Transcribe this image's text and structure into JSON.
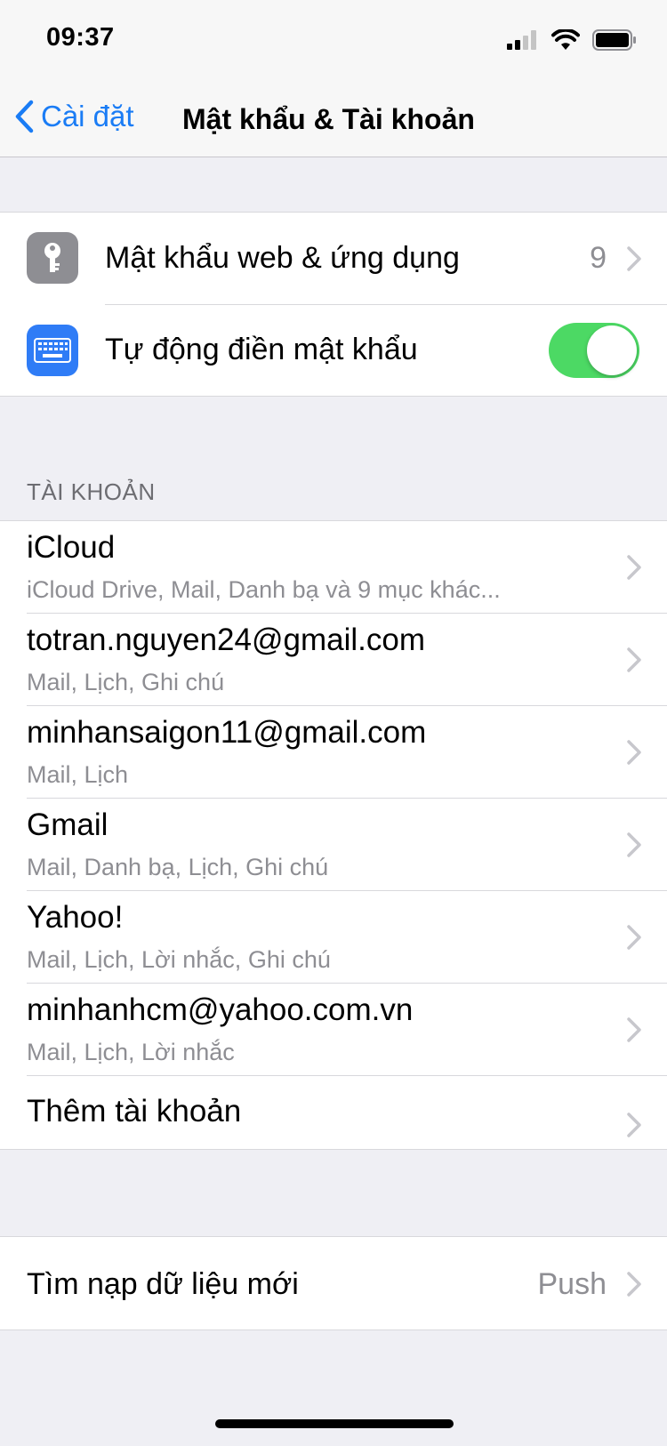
{
  "status_bar": {
    "time": "09:37",
    "icons": [
      "cellular-signal-icon",
      "wifi-icon",
      "battery-icon"
    ]
  },
  "nav": {
    "back_label": "Cài đặt",
    "title": "Mật khẩu & Tài khoản"
  },
  "password_group": {
    "web_passwords": {
      "label": "Mật khẩu web & ứng dụng",
      "value": "9",
      "icon": "key-icon",
      "icon_color": "#8e8e93"
    },
    "autofill": {
      "label": "Tự động điền mật khẩu",
      "enabled": true,
      "icon": "keyboard-icon",
      "icon_color": "#2f7cf6"
    }
  },
  "accounts": {
    "header": "TÀI KHOẢN",
    "items": [
      {
        "title": "iCloud",
        "subtitle": "iCloud Drive, Mail, Danh bạ và 9 mục khác..."
      },
      {
        "title": "totran.nguyen24@gmail.com",
        "subtitle": "Mail, Lịch, Ghi chú"
      },
      {
        "title": "minhansaigon11@gmail.com",
        "subtitle": "Mail, Lịch"
      },
      {
        "title": "Gmail",
        "subtitle": "Mail, Danh bạ, Lịch, Ghi chú"
      },
      {
        "title": "Yahoo!",
        "subtitle": "Mail, Lịch, Lời nhắc, Ghi chú"
      },
      {
        "title": "minhanhcm@yahoo.com.vn",
        "subtitle": "Mail, Lịch, Lời nhắc"
      }
    ],
    "add_account": "Thêm tài khoản"
  },
  "fetch": {
    "label": "Tìm nạp dữ liệu mới",
    "value": "Push"
  },
  "colors": {
    "accent": "#1a7cf5",
    "toggle_on": "#4cd964",
    "background": "#efeff4"
  }
}
